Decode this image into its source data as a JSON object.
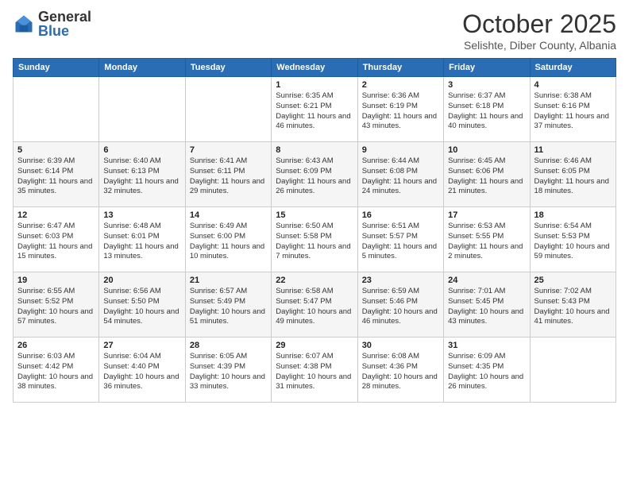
{
  "header": {
    "logo": {
      "general": "General",
      "blue": "Blue"
    },
    "title": "October 2025",
    "subtitle": "Selishte, Diber County, Albania"
  },
  "days_of_week": [
    "Sunday",
    "Monday",
    "Tuesday",
    "Wednesday",
    "Thursday",
    "Friday",
    "Saturday"
  ],
  "weeks": [
    [
      {
        "num": "",
        "sunrise": "",
        "sunset": "",
        "daylight": ""
      },
      {
        "num": "",
        "sunrise": "",
        "sunset": "",
        "daylight": ""
      },
      {
        "num": "",
        "sunrise": "",
        "sunset": "",
        "daylight": ""
      },
      {
        "num": "1",
        "sunrise": "Sunrise: 6:35 AM",
        "sunset": "Sunset: 6:21 PM",
        "daylight": "Daylight: 11 hours and 46 minutes."
      },
      {
        "num": "2",
        "sunrise": "Sunrise: 6:36 AM",
        "sunset": "Sunset: 6:19 PM",
        "daylight": "Daylight: 11 hours and 43 minutes."
      },
      {
        "num": "3",
        "sunrise": "Sunrise: 6:37 AM",
        "sunset": "Sunset: 6:18 PM",
        "daylight": "Daylight: 11 hours and 40 minutes."
      },
      {
        "num": "4",
        "sunrise": "Sunrise: 6:38 AM",
        "sunset": "Sunset: 6:16 PM",
        "daylight": "Daylight: 11 hours and 37 minutes."
      }
    ],
    [
      {
        "num": "5",
        "sunrise": "Sunrise: 6:39 AM",
        "sunset": "Sunset: 6:14 PM",
        "daylight": "Daylight: 11 hours and 35 minutes."
      },
      {
        "num": "6",
        "sunrise": "Sunrise: 6:40 AM",
        "sunset": "Sunset: 6:13 PM",
        "daylight": "Daylight: 11 hours and 32 minutes."
      },
      {
        "num": "7",
        "sunrise": "Sunrise: 6:41 AM",
        "sunset": "Sunset: 6:11 PM",
        "daylight": "Daylight: 11 hours and 29 minutes."
      },
      {
        "num": "8",
        "sunrise": "Sunrise: 6:43 AM",
        "sunset": "Sunset: 6:09 PM",
        "daylight": "Daylight: 11 hours and 26 minutes."
      },
      {
        "num": "9",
        "sunrise": "Sunrise: 6:44 AM",
        "sunset": "Sunset: 6:08 PM",
        "daylight": "Daylight: 11 hours and 24 minutes."
      },
      {
        "num": "10",
        "sunrise": "Sunrise: 6:45 AM",
        "sunset": "Sunset: 6:06 PM",
        "daylight": "Daylight: 11 hours and 21 minutes."
      },
      {
        "num": "11",
        "sunrise": "Sunrise: 6:46 AM",
        "sunset": "Sunset: 6:05 PM",
        "daylight": "Daylight: 11 hours and 18 minutes."
      }
    ],
    [
      {
        "num": "12",
        "sunrise": "Sunrise: 6:47 AM",
        "sunset": "Sunset: 6:03 PM",
        "daylight": "Daylight: 11 hours and 15 minutes."
      },
      {
        "num": "13",
        "sunrise": "Sunrise: 6:48 AM",
        "sunset": "Sunset: 6:01 PM",
        "daylight": "Daylight: 11 hours and 13 minutes."
      },
      {
        "num": "14",
        "sunrise": "Sunrise: 6:49 AM",
        "sunset": "Sunset: 6:00 PM",
        "daylight": "Daylight: 11 hours and 10 minutes."
      },
      {
        "num": "15",
        "sunrise": "Sunrise: 6:50 AM",
        "sunset": "Sunset: 5:58 PM",
        "daylight": "Daylight: 11 hours and 7 minutes."
      },
      {
        "num": "16",
        "sunrise": "Sunrise: 6:51 AM",
        "sunset": "Sunset: 5:57 PM",
        "daylight": "Daylight: 11 hours and 5 minutes."
      },
      {
        "num": "17",
        "sunrise": "Sunrise: 6:53 AM",
        "sunset": "Sunset: 5:55 PM",
        "daylight": "Daylight: 11 hours and 2 minutes."
      },
      {
        "num": "18",
        "sunrise": "Sunrise: 6:54 AM",
        "sunset": "Sunset: 5:53 PM",
        "daylight": "Daylight: 10 hours and 59 minutes."
      }
    ],
    [
      {
        "num": "19",
        "sunrise": "Sunrise: 6:55 AM",
        "sunset": "Sunset: 5:52 PM",
        "daylight": "Daylight: 10 hours and 57 minutes."
      },
      {
        "num": "20",
        "sunrise": "Sunrise: 6:56 AM",
        "sunset": "Sunset: 5:50 PM",
        "daylight": "Daylight: 10 hours and 54 minutes."
      },
      {
        "num": "21",
        "sunrise": "Sunrise: 6:57 AM",
        "sunset": "Sunset: 5:49 PM",
        "daylight": "Daylight: 10 hours and 51 minutes."
      },
      {
        "num": "22",
        "sunrise": "Sunrise: 6:58 AM",
        "sunset": "Sunset: 5:47 PM",
        "daylight": "Daylight: 10 hours and 49 minutes."
      },
      {
        "num": "23",
        "sunrise": "Sunrise: 6:59 AM",
        "sunset": "Sunset: 5:46 PM",
        "daylight": "Daylight: 10 hours and 46 minutes."
      },
      {
        "num": "24",
        "sunrise": "Sunrise: 7:01 AM",
        "sunset": "Sunset: 5:45 PM",
        "daylight": "Daylight: 10 hours and 43 minutes."
      },
      {
        "num": "25",
        "sunrise": "Sunrise: 7:02 AM",
        "sunset": "Sunset: 5:43 PM",
        "daylight": "Daylight: 10 hours and 41 minutes."
      }
    ],
    [
      {
        "num": "26",
        "sunrise": "Sunrise: 6:03 AM",
        "sunset": "Sunset: 4:42 PM",
        "daylight": "Daylight: 10 hours and 38 minutes."
      },
      {
        "num": "27",
        "sunrise": "Sunrise: 6:04 AM",
        "sunset": "Sunset: 4:40 PM",
        "daylight": "Daylight: 10 hours and 36 minutes."
      },
      {
        "num": "28",
        "sunrise": "Sunrise: 6:05 AM",
        "sunset": "Sunset: 4:39 PM",
        "daylight": "Daylight: 10 hours and 33 minutes."
      },
      {
        "num": "29",
        "sunrise": "Sunrise: 6:07 AM",
        "sunset": "Sunset: 4:38 PM",
        "daylight": "Daylight: 10 hours and 31 minutes."
      },
      {
        "num": "30",
        "sunrise": "Sunrise: 6:08 AM",
        "sunset": "Sunset: 4:36 PM",
        "daylight": "Daylight: 10 hours and 28 minutes."
      },
      {
        "num": "31",
        "sunrise": "Sunrise: 6:09 AM",
        "sunset": "Sunset: 4:35 PM",
        "daylight": "Daylight: 10 hours and 26 minutes."
      },
      {
        "num": "",
        "sunrise": "",
        "sunset": "",
        "daylight": ""
      }
    ]
  ]
}
